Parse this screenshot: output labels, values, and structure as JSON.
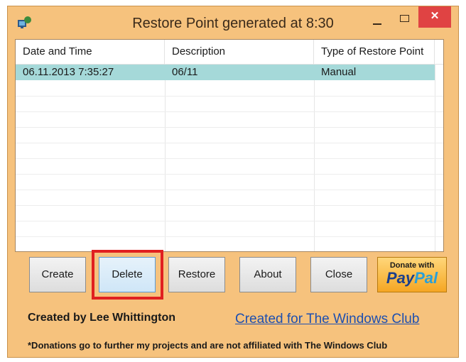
{
  "window": {
    "title": "Restore Point generated at 8:30",
    "close_glyph": "✕"
  },
  "table": {
    "columns": [
      "Date and Time",
      "Description",
      "Type of Restore Point"
    ],
    "rows": [
      [
        "06.11.2013 7:35:27",
        "06/11",
        "Manual"
      ]
    ]
  },
  "buttons": {
    "create": "Create",
    "delete": "Delete",
    "restore": "Restore",
    "about": "About",
    "close": "Close"
  },
  "paypal": {
    "top_label": "Donate with",
    "logo_pay": "Pay",
    "logo_pal": "Pal"
  },
  "footer": {
    "credit": "Created by Lee Whittington",
    "link": "Created for The Windows Club",
    "note": "*Donations go to further my projects and are not affiliated with The Windows Club"
  },
  "colors": {
    "window_frame": "#f6c27d",
    "selected_row": "#a5d9d9",
    "close_button": "#e04343",
    "highlight_box": "#e02020",
    "link": "#1d4fb0"
  },
  "icons": [
    "app-restore-icon",
    "minimize-icon",
    "maximize-icon",
    "close-icon"
  ]
}
